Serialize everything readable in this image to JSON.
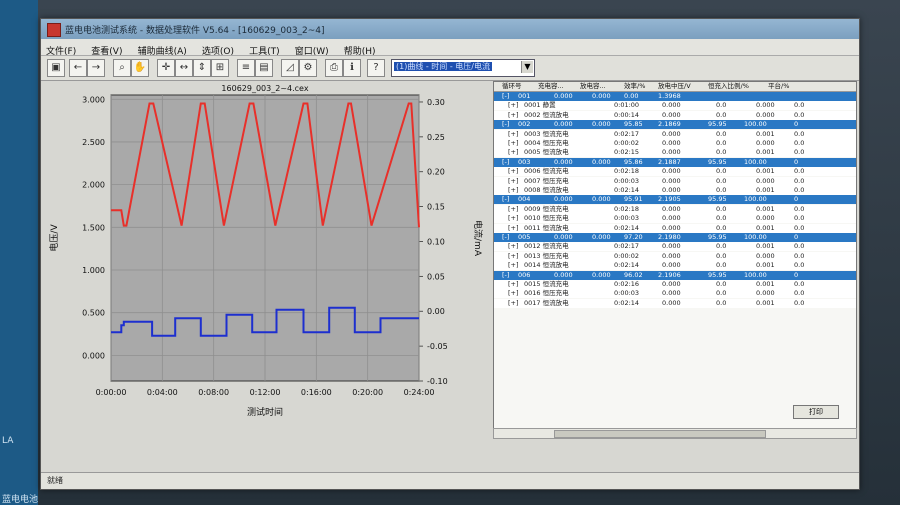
{
  "window": {
    "title": "蓝电电池测试系统 - 数据处理软件 V5.64 - [160629_003_2~4]"
  },
  "desktop": {
    "labels": [
      "LA",
      "蓝电电池"
    ]
  },
  "menu": [
    "文件(F)",
    "查看(V)",
    "辅助曲线(A)",
    "选项(O)",
    "工具(T)",
    "窗口(W)",
    "帮助(H)"
  ],
  "toolbar": {
    "view_selector": "(1)曲线 - 时间 - 电压/电流"
  },
  "chart_data": {
    "type": "line",
    "title": "160629_003_2~4.cex",
    "xlabel": "测试时间",
    "ylabel": "电压/V",
    "y2label": "电流/mA",
    "x_ticks": [
      "0:00:00",
      "0:04:00",
      "0:08:00",
      "0:12:00",
      "0:16:00",
      "0:20:00",
      "0:24:00"
    ],
    "y_ticks": [
      "3.000",
      "2.500",
      "2.000",
      "1.500",
      "1.000",
      "0.500",
      "0.000"
    ],
    "y2_ticks": [
      "0.30",
      "0.25",
      "0.20",
      "0.15",
      "0.10",
      "0.05",
      "0.00",
      "-0.05",
      "-0.10"
    ],
    "xlim": [
      0,
      24
    ],
    "ylim": [
      -0.3,
      3.05
    ],
    "y2lim": [
      -0.1,
      0.31
    ],
    "grid": true,
    "colors": {
      "voltage": "#e8302a",
      "current": "#1d2fcf",
      "plot_bg": "#a9a9a9"
    },
    "series": [
      {
        "axis": "left",
        "x": [
          0,
          0.8,
          1.0,
          1.2,
          3.0,
          3.3,
          5.5,
          7.0,
          7.3,
          8.8,
          10.8,
          11.1,
          12.8,
          15.0,
          15.3,
          16.5,
          18.5,
          18.7,
          20.3,
          23.2,
          23.4,
          24.0
        ],
        "y": [
          1.7,
          1.7,
          1.52,
          1.52,
          2.95,
          2.95,
          1.52,
          2.95,
          2.95,
          1.52,
          2.95,
          2.95,
          1.52,
          2.95,
          2.95,
          1.52,
          2.95,
          2.95,
          1.52,
          2.95,
          2.95,
          1.5
        ]
      },
      {
        "axis": "right",
        "x": [
          0,
          0.8,
          0.8,
          1.0,
          1.0,
          3.2,
          3.2,
          5.0,
          5.0,
          7.0,
          7.0,
          9.0,
          9.0,
          11.0,
          11.0,
          12.9,
          12.9,
          15.0,
          15.0,
          17.0,
          17.0,
          19.0,
          19.0,
          21.0,
          21.0,
          24.0
        ],
        "y": [
          -0.03,
          -0.03,
          -0.02,
          -0.02,
          -0.015,
          -0.015,
          -0.035,
          -0.035,
          -0.01,
          -0.01,
          -0.035,
          -0.035,
          -0.005,
          -0.005,
          -0.03,
          -0.03,
          0.002,
          0.002,
          -0.03,
          -0.03,
          0.005,
          0.005,
          -0.03,
          -0.03,
          -0.01,
          -0.01
        ]
      }
    ]
  },
  "table": {
    "headers": [
      "循环号",
      "充电容...",
      "放电容...",
      "效率/%",
      "放电中压/V",
      "恒充入比例/%",
      "平台/%"
    ],
    "rows": [
      {
        "kind": "cycle",
        "cells": [
          "[-]",
          "001",
          "0.000",
          "0.000",
          "0.00",
          "1.3968",
          "",
          "",
          ""
        ]
      },
      {
        "kind": "step",
        "cells": [
          "[+]",
          "0001 静置",
          "0:01:00",
          "0.000",
          "0.0",
          "0.000",
          "0.0"
        ]
      },
      {
        "kind": "step",
        "cells": [
          "[+]",
          "0002 恒流放电",
          "0:00:14",
          "0.000",
          "0.0",
          "0.000",
          "0.0"
        ]
      },
      {
        "kind": "cycle",
        "cells": [
          "[-]",
          "002",
          "0.000",
          "0.000",
          "95.85",
          "2.1869",
          "95.95",
          "100.00",
          "0"
        ]
      },
      {
        "kind": "step",
        "cells": [
          "[+]",
          "0003 恒流充电",
          "0:02:17",
          "0.000",
          "0.0",
          "0.001",
          "0.0"
        ]
      },
      {
        "kind": "step",
        "cells": [
          "[+]",
          "0004 恒压充电",
          "0:00:02",
          "0.000",
          "0.0",
          "0.000",
          "0.0"
        ]
      },
      {
        "kind": "step",
        "cells": [
          "[+]",
          "0005 恒流放电",
          "0:02:15",
          "0.000",
          "0.0",
          "0.001",
          "0.0"
        ]
      },
      {
        "kind": "cycle",
        "cells": [
          "[-]",
          "003",
          "0.000",
          "0.000",
          "95.86",
          "2.1887",
          "95.95",
          "100.00",
          "0"
        ]
      },
      {
        "kind": "step",
        "cells": [
          "[+]",
          "0006 恒流充电",
          "0:02:18",
          "0.000",
          "0.0",
          "0.001",
          "0.0"
        ]
      },
      {
        "kind": "step",
        "cells": [
          "[+]",
          "0007 恒压充电",
          "0:00:03",
          "0.000",
          "0.0",
          "0.000",
          "0.0"
        ]
      },
      {
        "kind": "step",
        "cells": [
          "[+]",
          "0008 恒流放电",
          "0:02:14",
          "0.000",
          "0.0",
          "0.001",
          "0.0"
        ]
      },
      {
        "kind": "cycle",
        "cells": [
          "[-]",
          "004",
          "0.000",
          "0.000",
          "95.91",
          "2.1905",
          "95.95",
          "100.00",
          "0"
        ]
      },
      {
        "kind": "step",
        "cells": [
          "[+]",
          "0009 恒流充电",
          "0:02:18",
          "0.000",
          "0.0",
          "0.001",
          "0.0"
        ]
      },
      {
        "kind": "step",
        "cells": [
          "[+]",
          "0010 恒压充电",
          "0:00:03",
          "0.000",
          "0.0",
          "0.000",
          "0.0"
        ]
      },
      {
        "kind": "step",
        "cells": [
          "[+]",
          "0011 恒流放电",
          "0:02:14",
          "0.000",
          "0.0",
          "0.001",
          "0.0"
        ]
      },
      {
        "kind": "cycle",
        "cells": [
          "[-]",
          "005",
          "0.000",
          "0.000",
          "97.20",
          "2.1980",
          "95.95",
          "100.00",
          "0"
        ]
      },
      {
        "kind": "step",
        "cells": [
          "[+]",
          "0012 恒流充电",
          "0:02:17",
          "0.000",
          "0.0",
          "0.001",
          "0.0"
        ]
      },
      {
        "kind": "step",
        "cells": [
          "[+]",
          "0013 恒压充电",
          "0:00:02",
          "0.000",
          "0.0",
          "0.000",
          "0.0"
        ]
      },
      {
        "kind": "step",
        "cells": [
          "[+]",
          "0014 恒流放电",
          "0:02:14",
          "0.000",
          "0.0",
          "0.001",
          "0.0"
        ]
      },
      {
        "kind": "cycle",
        "cells": [
          "[-]",
          "006",
          "0.000",
          "0.000",
          "96.02",
          "2.1906",
          "95.95",
          "100.00",
          "0"
        ]
      },
      {
        "kind": "step",
        "cells": [
          "[+]",
          "0015 恒流充电",
          "0:02:16",
          "0.000",
          "0.0",
          "0.001",
          "0.0"
        ]
      },
      {
        "kind": "step",
        "cells": [
          "[+]",
          "0016 恒压充电",
          "0:00:03",
          "0.000",
          "0.0",
          "0.000",
          "0.0"
        ]
      },
      {
        "kind": "step",
        "cells": [
          "[+]",
          "0017 恒流放电",
          "0:02:14",
          "0.000",
          "0.0",
          "0.001",
          "0.0"
        ]
      }
    ]
  },
  "buttons": {
    "print": "打印"
  },
  "status": "就绪"
}
